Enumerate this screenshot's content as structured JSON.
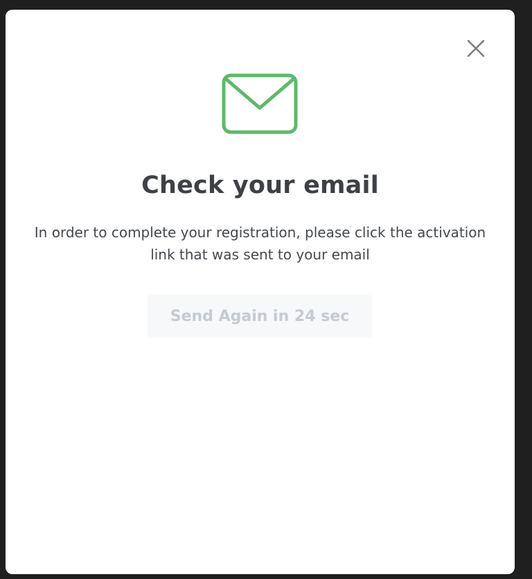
{
  "modal": {
    "title": "Check your email",
    "description": "In order to complete your registration, please click the activation link that was sent to your email",
    "resend_label": "Send Again in 24 sec",
    "icons": {
      "main": "envelope-icon",
      "close": "close-icon"
    },
    "colors": {
      "accent": "#5cb96a",
      "title": "#3d4147",
      "body_text": "#44484e",
      "disabled_text": "#c5cbd1",
      "disabled_bg": "#f6f8fa",
      "overlay": "#1f1f1f"
    }
  }
}
